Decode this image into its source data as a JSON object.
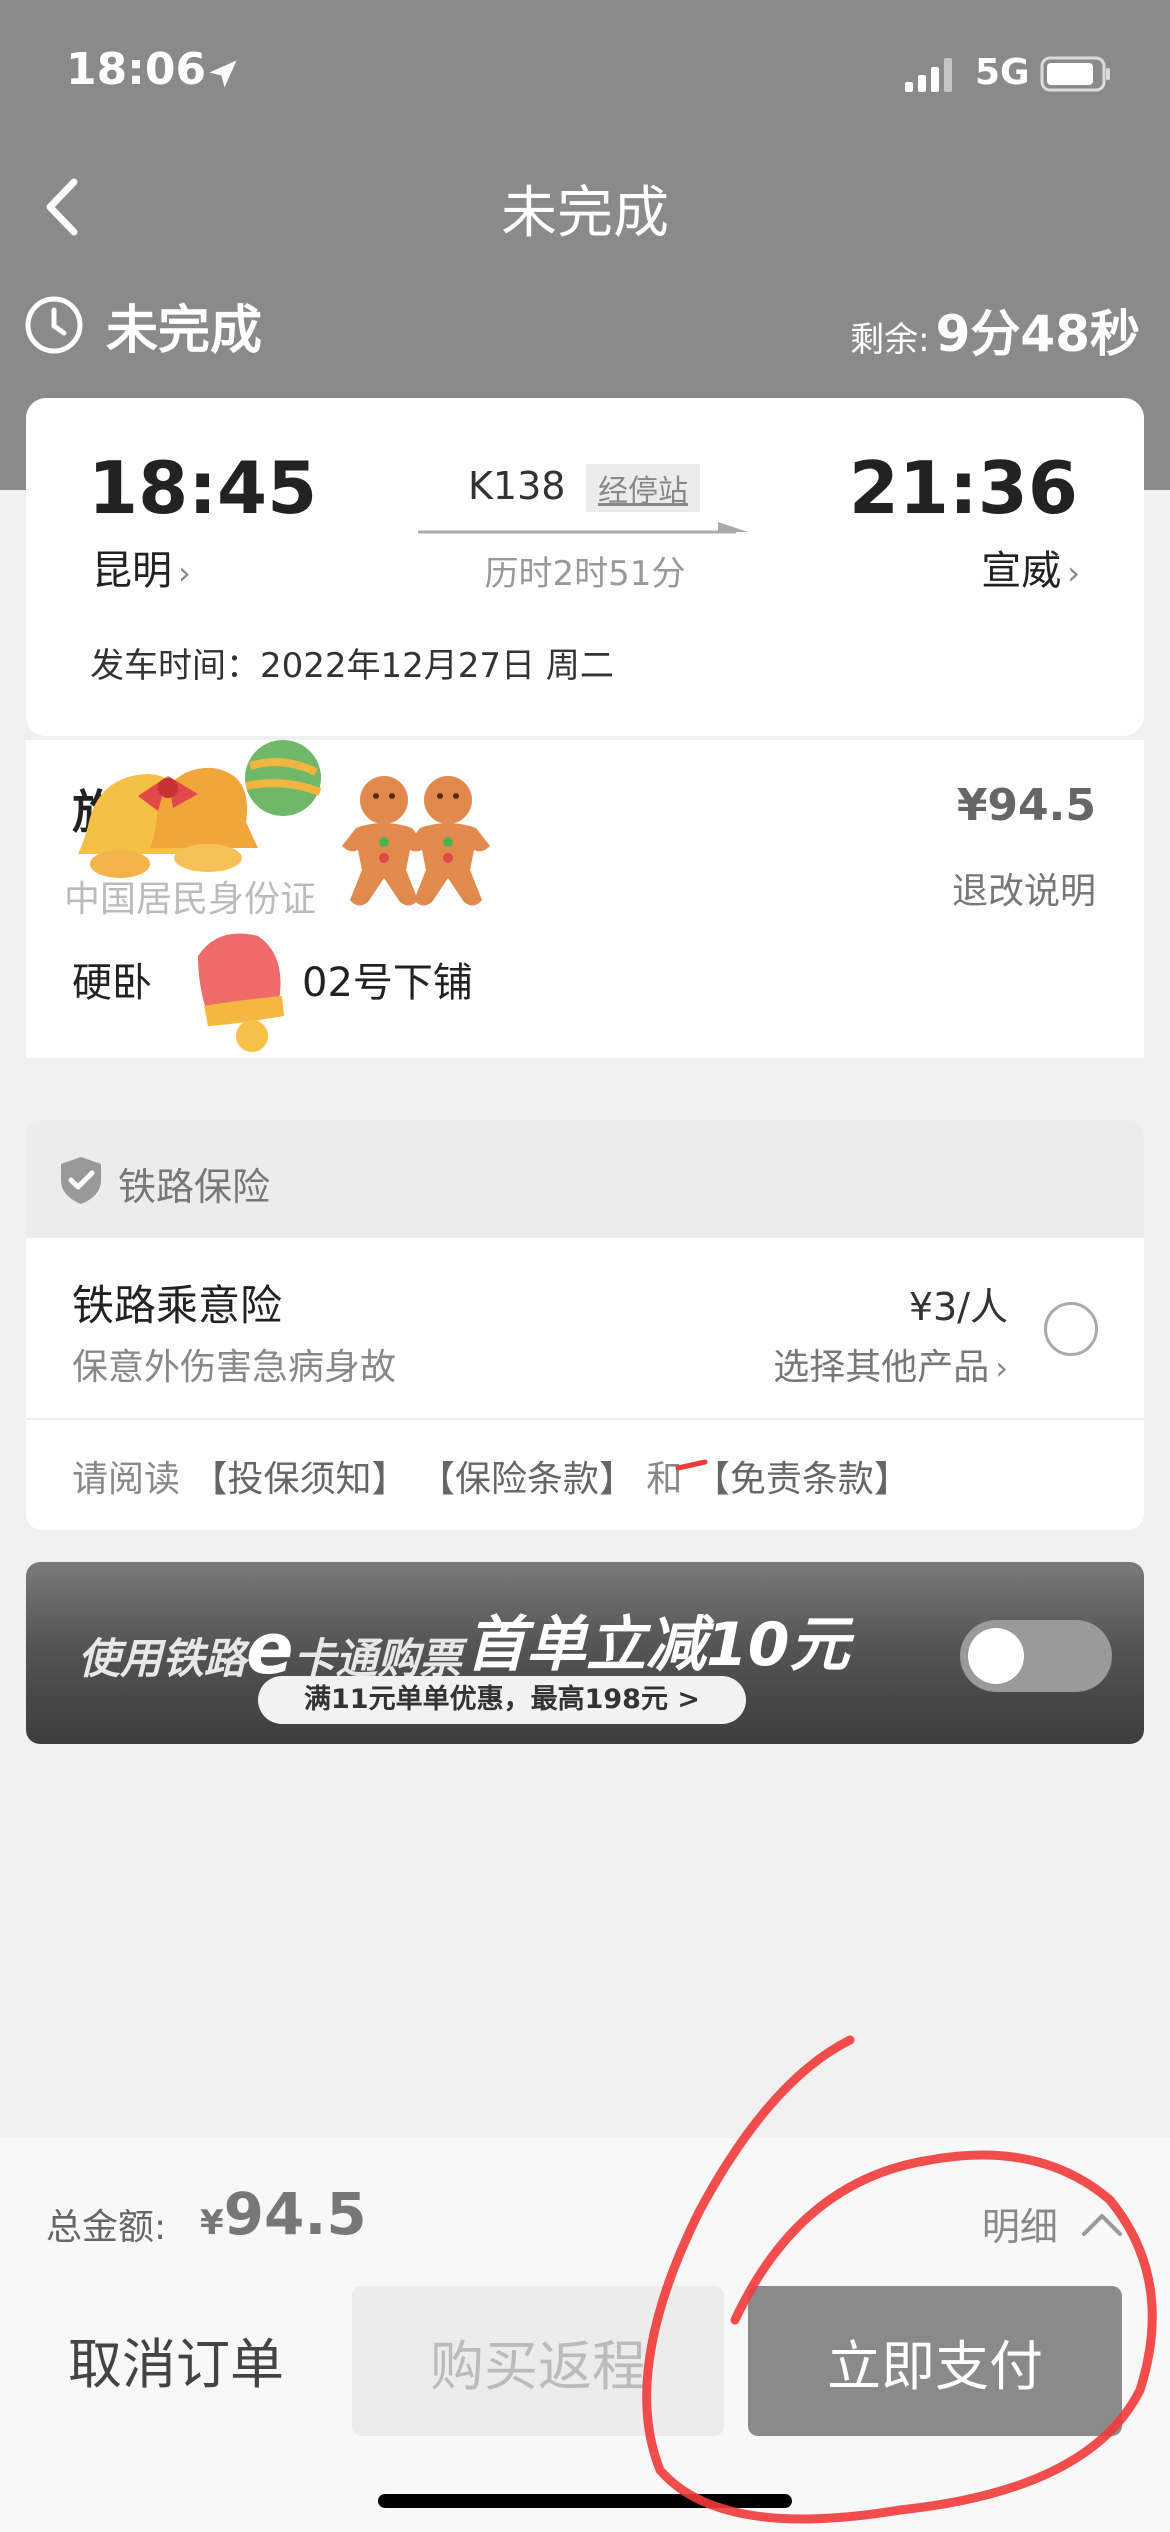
{
  "status_bar": {
    "time": "18:06",
    "network": "5G"
  },
  "nav": {
    "title": "未完成"
  },
  "order": {
    "status": "未完成",
    "remaining_label": "剩余:",
    "remaining_value": "9分48秒"
  },
  "trip": {
    "departure_time": "18:45",
    "departure_station": "昆明",
    "arrival_time": "21:36",
    "arrival_station": "宣威",
    "train_no": "K138",
    "stops_label": "经停站",
    "duration": "历时2时51分",
    "departure_date": "发车时间：2022年12月27日 周二"
  },
  "passenger": {
    "name": "旅",
    "id_type": "中国居民身份证",
    "seat_prefix": "硬卧",
    "seat_suffix": "02号下铺",
    "price": "¥94.5",
    "refund_label": "退改说明"
  },
  "insurance": {
    "section_title": "铁路保险",
    "product_name": "铁路乘意险",
    "product_desc": "保意外伤害急病身故",
    "price": "¥3/人",
    "other_products": "选择其他产品",
    "terms_prefix": "请阅读",
    "terms_notice": "【投保须知】",
    "terms_clauses": "【保险条款】",
    "terms_and": "和",
    "terms_disclaimer": "【免责条款】"
  },
  "promo": {
    "text_left_a": "使用铁路",
    "text_left_e": "e",
    "text_left_b": "卡通购票",
    "text_main": "首单立减10元",
    "sub": "满11元单单优惠，最高198元 >",
    "toggle_on": false
  },
  "bottom": {
    "total_label": "总金额:",
    "total_currency": "¥",
    "total_amount": "94.5",
    "detail_label": "明细",
    "cancel_label": "取消订单",
    "return_label": "购买返程",
    "pay_label": "立即支付"
  },
  "colors": {
    "header_bg": "#8a8a8a",
    "annotation_red": "#f03a3a",
    "pay_button": "#8a8a8a"
  }
}
